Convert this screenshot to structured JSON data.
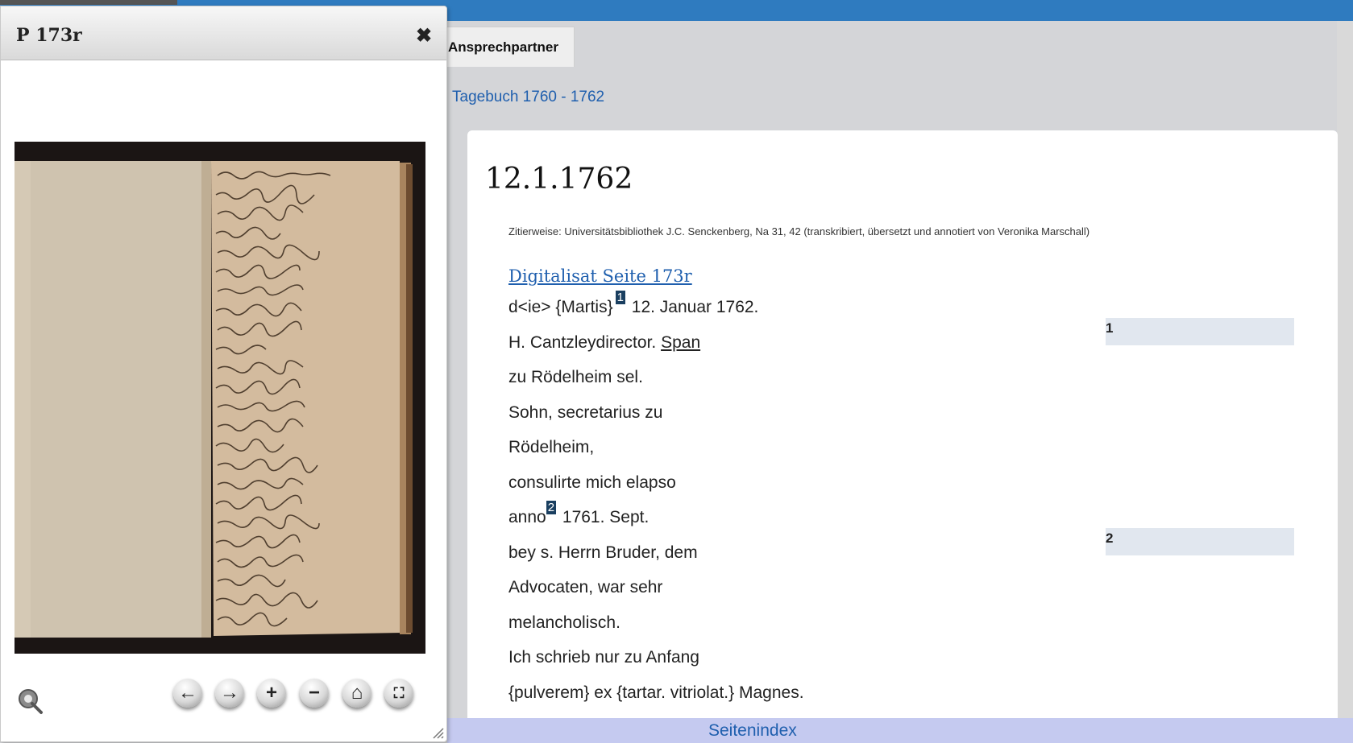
{
  "header": {
    "tab_label": "Ansprechpartner"
  },
  "breadcrumb": "Tagebuch 1760 - 1762",
  "entry": {
    "date": "12.1.1762",
    "citation": "Zitierweise: Universitätsbibliothek J.C. Senckenberg, Na 31, 42 (transkribiert, übersetzt und annotiert von Veronika Marschall)",
    "digitalisat_link": "Digitalisat Seite 173r",
    "lines": [
      {
        "before": "d<ie> {Martis}",
        "fn": "1",
        "after": " 12. Januar 1762."
      },
      {
        "before": "H. Cantzleydirector. ",
        "link": "Span"
      },
      {
        "before": "zu Rödelheim sel."
      },
      {
        "before": "Sohn, secretarius zu"
      },
      {
        "before": "Rödelheim,"
      },
      {
        "before": "consulirte mich elapso"
      },
      {
        "before": "anno",
        "fn": "2",
        "after": " 1761. Sept."
      },
      {
        "before": "bey s. Herrn Bruder, dem"
      },
      {
        "before": "Advocaten, war sehr"
      },
      {
        "before": "melancholisch."
      },
      {
        "before": "Ich schrieb nur zu Anfang"
      },
      {
        "before": "{pulverem} ex {tartar. vitriolat.} Magnes."
      }
    ],
    "notes": [
      "1",
      "2"
    ]
  },
  "footer": {
    "page_index": "Seitenindex"
  },
  "viewer": {
    "title": "P 173r",
    "controls": [
      {
        "icon": "previous-arrow-icon",
        "glyph": "←"
      },
      {
        "icon": "next-arrow-icon",
        "glyph": "→"
      },
      {
        "icon": "zoom-in-icon",
        "glyph": "+"
      },
      {
        "icon": "zoom-out-icon",
        "glyph": "−"
      },
      {
        "icon": "home-icon",
        "glyph": "⌂"
      },
      {
        "icon": "fullscreen-icon",
        "glyph": "⛶"
      }
    ]
  }
}
